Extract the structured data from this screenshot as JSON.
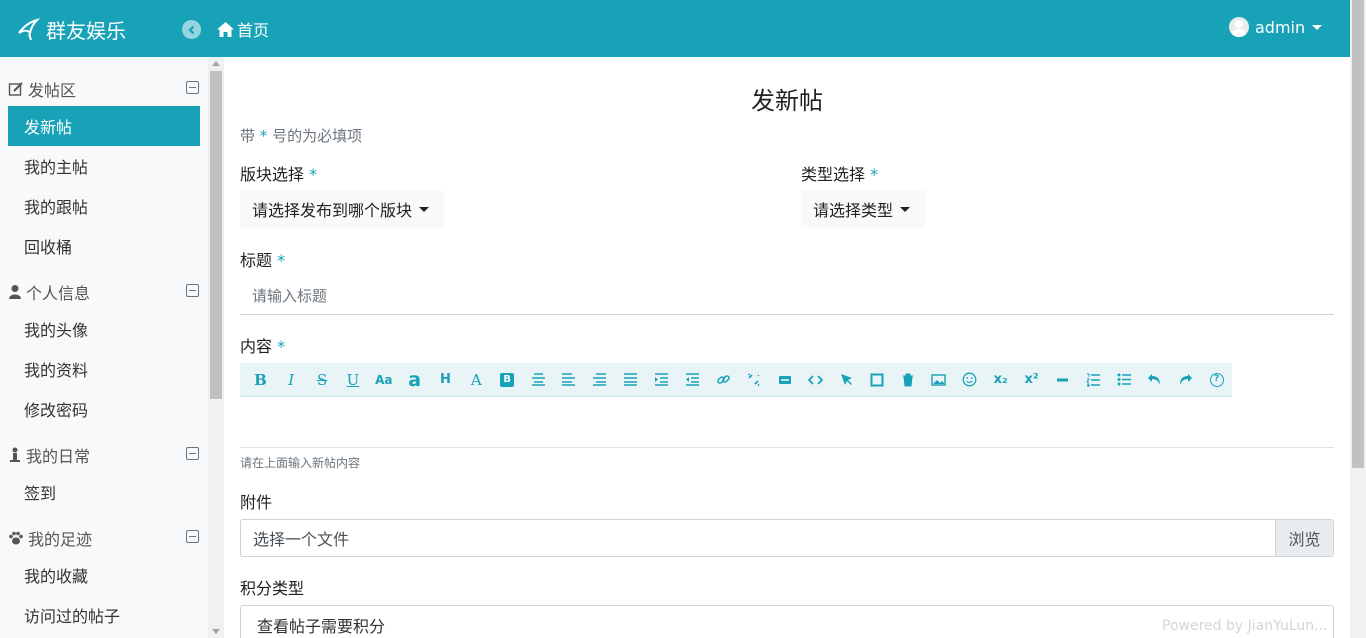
{
  "navbar": {
    "brand": "群友娱乐",
    "home": "首页",
    "user": "admin",
    "bg_color": "#17a2b8"
  },
  "sidebar": {
    "sections": [
      {
        "title": "发帖区",
        "icon": "edit-icon",
        "items": [
          "发新帖",
          "我的主帖",
          "我的跟帖",
          "回收桶"
        ]
      },
      {
        "title": "个人信息",
        "icon": "user-icon",
        "items": [
          "我的头像",
          "我的资料",
          "修改密码"
        ]
      },
      {
        "title": "我的日常",
        "icon": "person-standing-icon",
        "items": [
          "签到"
        ]
      },
      {
        "title": "我的足迹",
        "icon": "paw-icon",
        "items": [
          "我的收藏",
          "访问过的帖子"
        ]
      }
    ],
    "active_item": "发新帖"
  },
  "form": {
    "title": "发新帖",
    "required_note_prefix": "带",
    "required_star": "*",
    "required_note_suffix": "号的为必填项",
    "board_label": "版块选择",
    "board_select": "请选择发布到哪个版块",
    "type_label": "类型选择",
    "type_select": "请选择类型",
    "subject_label": "标题",
    "subject_placeholder": "请输入标题",
    "content_label": "内容",
    "content_help": "请在上面输入新帖内容",
    "attachment_label": "附件",
    "file_placeholder": "选择一个文件",
    "browse": "浏览",
    "points_label": "积分类型",
    "points_select": "查看帖子需要积分"
  },
  "editor_toolbar": [
    "bold-icon",
    "italic-icon",
    "strikethrough-icon",
    "underline-icon",
    "font-size-icon",
    "font-a-icon",
    "heading-icon",
    "font-color-icon",
    "background-color-icon",
    "align-center-icon",
    "align-left-icon",
    "align-right-icon",
    "align-justify-icon",
    "indent-icon",
    "outdent-icon",
    "link-icon",
    "unlink-icon",
    "horizontal-rule-icon",
    "code-icon",
    "pointer-icon",
    "square-icon",
    "clear-format-icon",
    "image-icon",
    "emoji-icon",
    "subscript-icon",
    "superscript-icon",
    "minus-icon",
    "ordered-list-icon",
    "unordered-list-icon",
    "undo-icon",
    "redo-icon",
    "help-icon"
  ],
  "toolbar_glyphs": {
    "bold": "B",
    "italic": "I",
    "strike": "S",
    "underline": "U",
    "fontsize": "Aa",
    "fonta": "a",
    "heading": "H",
    "fontcolor": "A",
    "bgcolor": "B",
    "sub": "x₂",
    "sup": "x²",
    "help": "?"
  },
  "watermark": "Powered by JianYuLun..."
}
